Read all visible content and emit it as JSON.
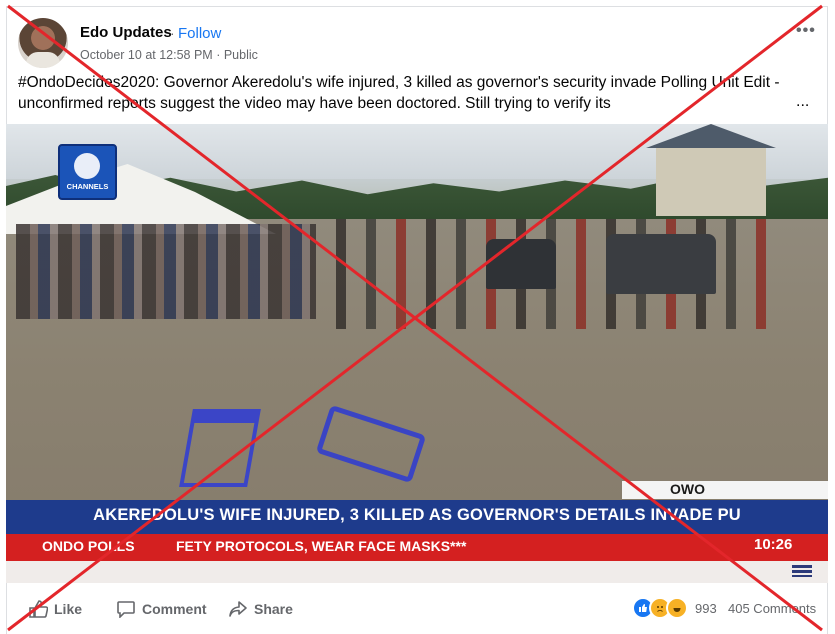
{
  "post": {
    "page_name": "Edo Updates",
    "separator": "·",
    "follow_label": "Follow",
    "meta": "October 10 at 12:58 PM · Public",
    "more_label": "•••",
    "text": "#OndoDecides2020: Governor Akeredolu's wife injured, 3 killed as governor's security invade Polling Unit Edit - unconfirmed reports suggest the video may have been doctored. Still trying to verify its",
    "ellipsis": "..."
  },
  "video": {
    "channel_logo": "CHANNELS",
    "location": "OWO",
    "headline": "AKEREDOLU'S WIFE INJURED, 3 KILLED AS GOVERNOR'S DETAILS INVADE PU",
    "ticker_label": "ONDO POLLS",
    "ticker_text": "FETY PROTOCOLS, WEAR FACE MASKS***",
    "time": "10:26"
  },
  "actions": {
    "like_label": "Like",
    "comment_label": "Comment",
    "share_label": "Share",
    "reaction_count": "993",
    "comment_count": "405 Comments"
  },
  "overlay": {
    "cross_color": "#e3262b"
  }
}
